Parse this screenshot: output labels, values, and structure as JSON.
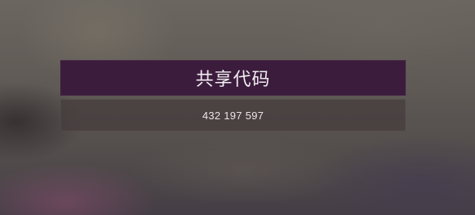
{
  "dialog": {
    "title": "共享代码",
    "share_code": "432 197 597"
  }
}
